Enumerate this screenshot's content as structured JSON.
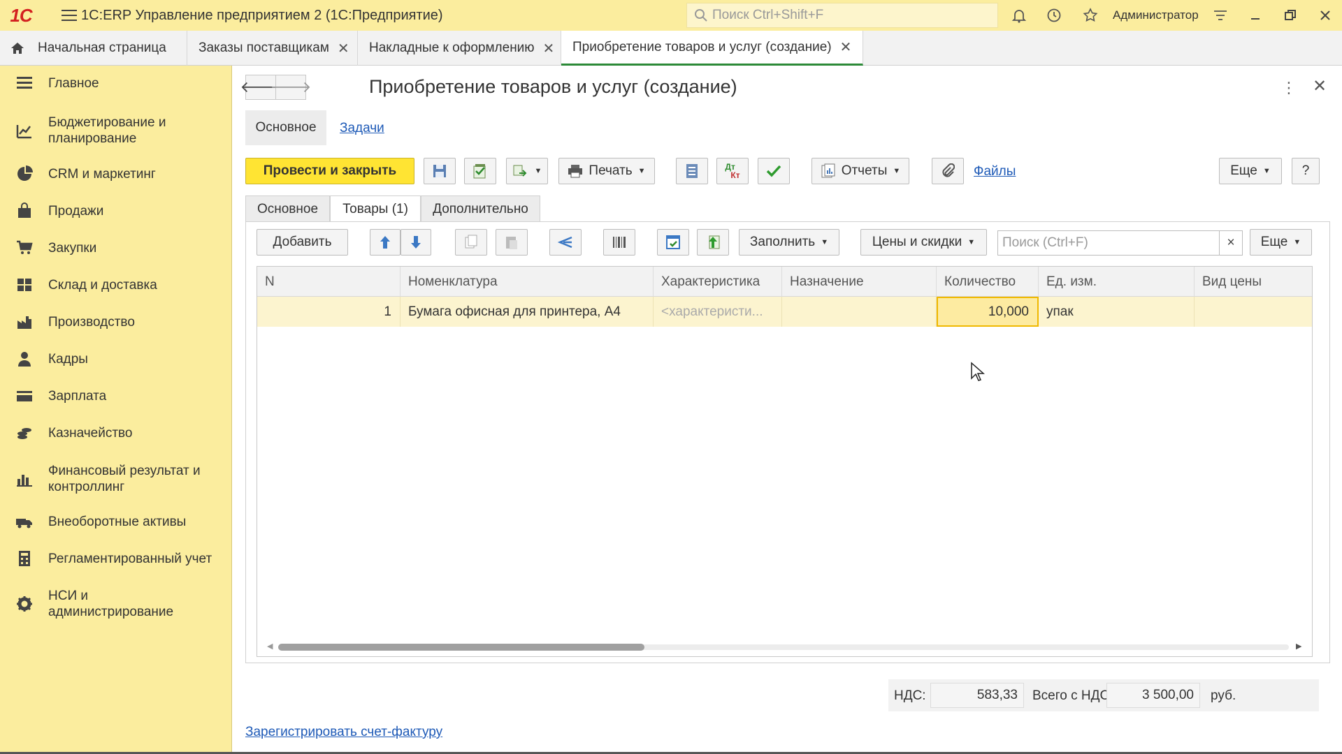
{
  "app": {
    "logo": "1С",
    "title": "1С:ERP Управление предприятием 2  (1С:Предприятие)",
    "search_placeholder": "Поиск Ctrl+Shift+F",
    "user": "Администратор"
  },
  "tabs": [
    {
      "label": "Начальная страница"
    },
    {
      "label": "Заказы поставщикам"
    },
    {
      "label": "Накладные к оформлению"
    },
    {
      "label": "Приобретение товаров и услуг (создание)"
    }
  ],
  "sidebar": {
    "items": [
      {
        "label": "Главное",
        "icon": "menu-icon"
      },
      {
        "label": "Бюджетирование и планирование",
        "icon": "budget-icon"
      },
      {
        "label": "CRM и маркетинг",
        "icon": "pie-icon"
      },
      {
        "label": "Продажи",
        "icon": "bag-icon"
      },
      {
        "label": "Закупки",
        "icon": "cart-icon"
      },
      {
        "label": "Склад и доставка",
        "icon": "warehouse-icon"
      },
      {
        "label": "Производство",
        "icon": "factory-icon"
      },
      {
        "label": "Кадры",
        "icon": "person-icon"
      },
      {
        "label": "Зарплата",
        "icon": "card-icon"
      },
      {
        "label": "Казначейство",
        "icon": "coins-icon"
      },
      {
        "label": "Финансовый результат и контроллинг",
        "icon": "chart-icon"
      },
      {
        "label": "Внеоборотные активы",
        "icon": "truck-icon"
      },
      {
        "label": "Регламентированный учет",
        "icon": "calculator-icon"
      },
      {
        "label": "НСИ и администрирование",
        "icon": "gear-icon"
      }
    ]
  },
  "document": {
    "title": "Приобретение товаров и услуг (создание)",
    "subtabs": {
      "main": "Основное",
      "tasks": "Задачи"
    },
    "toolbar": {
      "post_close": "Провести и закрыть",
      "print": "Печать",
      "reports": "Отчеты",
      "files": "Файлы",
      "more": "Еще",
      "help": "?"
    },
    "form_tabs": [
      "Основное",
      "Товары (1)",
      "Дополнительно"
    ],
    "table_toolbar": {
      "add": "Добавить",
      "fill": "Заполнить",
      "prices": "Цены и скидки",
      "search_placeholder": "Поиск (Ctrl+F)",
      "clear": "×",
      "more": "Еще"
    },
    "table": {
      "columns": [
        "N",
        "Номенклатура",
        "Характеристика",
        "Назначение",
        "Количество",
        "Ед. изм.",
        "Вид цены"
      ],
      "rows": [
        {
          "n": "1",
          "item": "Бумага офисная для принтера, А4",
          "characteristic": "<характеристи...",
          "purpose": "",
          "qty": "10,000",
          "unit": "упак",
          "price_type": ""
        }
      ]
    },
    "totals": {
      "vat_label": "НДС:",
      "vat_value": "583,33",
      "total_label": "Всего с НДС:",
      "total_value": "3 500,00",
      "currency": "руб."
    },
    "invoice_link": "Зарегистрировать счет-фактуру"
  }
}
